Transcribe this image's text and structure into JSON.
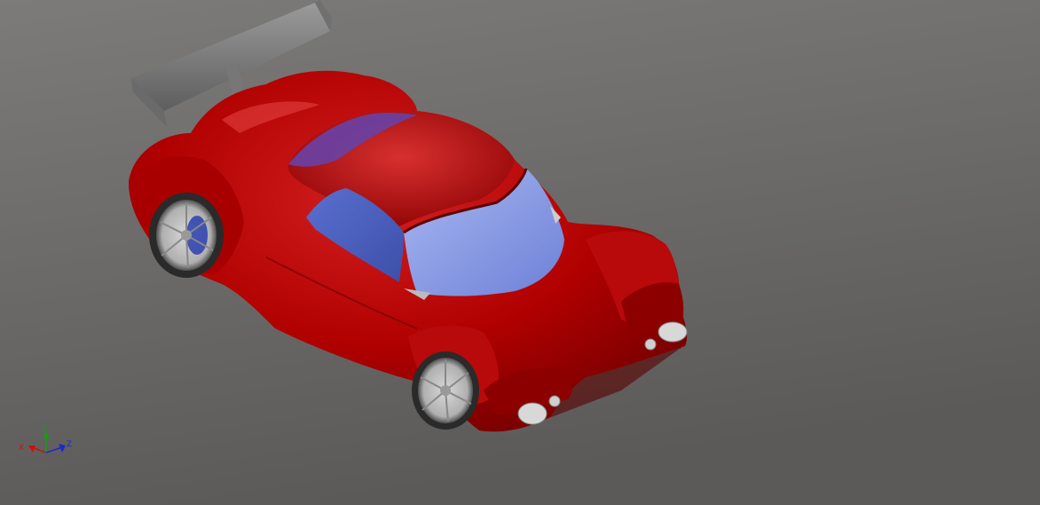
{
  "viewport": {
    "background_top": "#7a7a7a",
    "background_bottom": "#5a5a5a",
    "model": {
      "body_color": "#b30000",
      "body_shade": "#7d0000",
      "body_highlight": "#e23a3a",
      "glass_color": "#8aa0e8",
      "glass_dark": "#4f5fb8",
      "roof_glass": "#6a3d9a",
      "wing_color": "#8a8a8a",
      "wheel_color": "#b8b8b8",
      "brake_color": "#2a3fb0"
    }
  },
  "triad": {
    "x_label": "X",
    "y_label": "Y",
    "z_label": "Z",
    "x_color": "#cc1111",
    "y_color": "#1a9a1a",
    "z_color": "#1a2acc"
  }
}
